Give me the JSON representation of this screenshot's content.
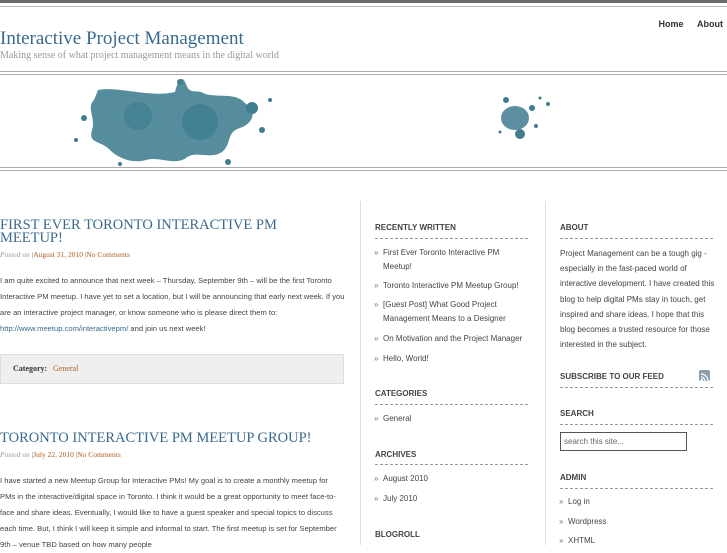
{
  "nav": {
    "home": "Home",
    "about": "About"
  },
  "site": {
    "title": "Interactive Project Management",
    "tagline": "Making sense of what project management means in the digital world"
  },
  "posts": [
    {
      "title": "First Ever Toronto Interactive PM Meetup!",
      "posted_on": "Posted on",
      "date": "August 31, 2010",
      "comments": "No Comments",
      "body_text": "I am quite excited to announce that next week – Thursday, September 9th – will be the first Toronto Interactive PM meetup. I have yet to set a location, but I will be announcing that early next week. If you are an interactive project manager, or know someone who is please direct them to: ",
      "body_url": "http://www.meetup.com/interactivepm/",
      "body_tail": " and join us next week!",
      "category_label": "Category:",
      "category": "General"
    },
    {
      "title": "Toronto Interactive PM Meetup Group!",
      "posted_on": "Posted on",
      "date": "July 22, 2010",
      "comments": "No Comments",
      "body_text": "I have started a new Meetup Group for Interactive PMs! My goal is to create a monthly meetup for PMs in the interactive/digital space in Toronto. I think it would be a great opportunity to meet face-to-face and share ideas. Eventually, I would like to have a guest speaker and special topics to discuss each time. But, I think I will keep it simple and informal to start. The first meetup is set for September 9th – venue TBD based on how many people"
    }
  ],
  "sidebar": {
    "recent_heading": "Recently Written",
    "recent": [
      "First Ever Toronto Interactive PM Meetup!",
      "Toronto Interactive PM Meetup Group!",
      "[Guest Post] What Good Project Management Means to a Designer",
      "On Motivation and the Project Manager",
      "Hello, World!"
    ],
    "categories_heading": "Categories",
    "categories": [
      "General"
    ],
    "archives_heading": "Archives",
    "archives": [
      "August 2010",
      "July 2010"
    ],
    "blogroll_heading": "Blogroll",
    "about_heading": "About",
    "about_text": "Project Management can be a tough gig - especially in the fast-paced world of interactive development. I have created this blog to help digital PMs stay in touch, get inspired and share ideas. I hope that this blog becomes a trusted resource for those interested in the subject.",
    "subscribe_heading": "Subscribe to our feed",
    "search_heading": "Search",
    "search_value": "search this site...",
    "admin_heading": "Admin",
    "admin": [
      "Log in",
      "Wordpress",
      "XHTML"
    ]
  },
  "colors": {
    "title": "#3a6a8c",
    "splash": "#3f7d8f",
    "link": "#b05a1a"
  }
}
